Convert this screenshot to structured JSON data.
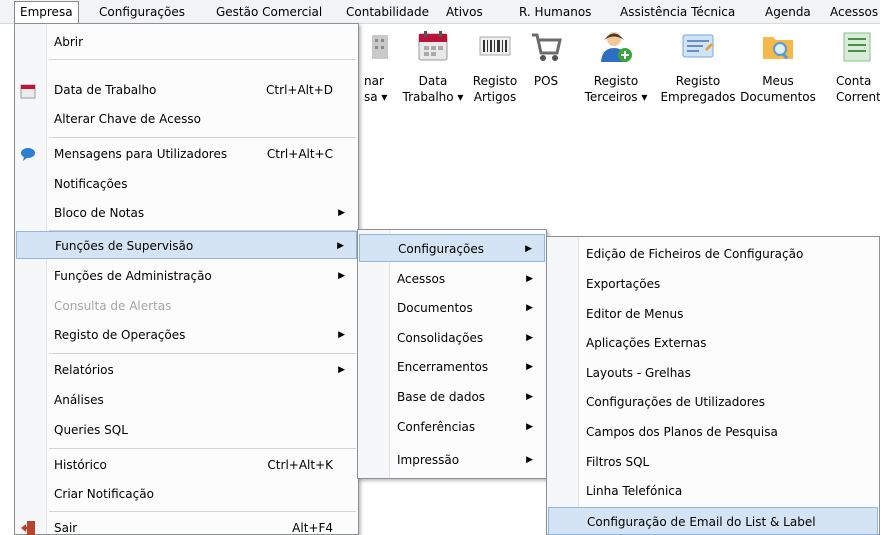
{
  "menubar": {
    "items": [
      "Empresa",
      "Configurações",
      "Gestão Comercial",
      "Contabilidade",
      "Ativos",
      "R. Humanos",
      "Assistência Técnica",
      "Agenda",
      "Acessos"
    ]
  },
  "toolbar": {
    "buttons": [
      {
        "label": "nar\nsa ▾"
      },
      {
        "label": "Data\nTrabalho ▾"
      },
      {
        "label": "Registo\nArtigos"
      },
      {
        "label": "POS"
      },
      {
        "label": "Registo\nTerceiros ▾"
      },
      {
        "label": "Registo\nEmpregados"
      },
      {
        "label": "Meus\nDocumentos"
      },
      {
        "label": "Conta\nCorrente"
      }
    ]
  },
  "menu_empresa": {
    "items": [
      {
        "label": "Abrir",
        "shortcut": ""
      },
      {
        "label": "Data de Trabalho",
        "shortcut": "Ctrl+Alt+D"
      },
      {
        "label": "Alterar Chave de Acesso",
        "shortcut": ""
      },
      {
        "label": "Mensagens para Utilizadores",
        "shortcut": "Ctrl+Alt+C"
      },
      {
        "label": "Notificações",
        "shortcut": ""
      },
      {
        "label": "Bloco de Notas",
        "shortcut": ""
      },
      {
        "label": "Funções de Supervisão",
        "shortcut": ""
      },
      {
        "label": "Funções de Administração",
        "shortcut": ""
      },
      {
        "label": "Consulta de Alertas",
        "shortcut": ""
      },
      {
        "label": "Registo de Operações",
        "shortcut": ""
      },
      {
        "label": "Relatórios",
        "shortcut": ""
      },
      {
        "label": "Análises",
        "shortcut": ""
      },
      {
        "label": "Queries SQL",
        "shortcut": ""
      },
      {
        "label": "Histórico",
        "shortcut": "Ctrl+Alt+K"
      },
      {
        "label": "Criar Notificação",
        "shortcut": ""
      },
      {
        "label": "Sair",
        "shortcut": "Alt+F4"
      }
    ]
  },
  "menu_supervisao": {
    "items": [
      "Configurações",
      "Acessos",
      "Documentos",
      "Consolidações",
      "Encerramentos",
      "Base de dados",
      "Conferências",
      "Impressão"
    ]
  },
  "menu_configuracoes": {
    "items": [
      "Edição de Ficheiros de Configuração",
      "Exportações",
      "Editor de Menus",
      "Aplicações Externas",
      "Layouts - Grelhas",
      "Configurações de Utilizadores",
      "Campos dos Planos de Pesquisa",
      "Filtros SQL",
      "Linha Telefónica",
      "Configuração de Email do List & Label"
    ]
  },
  "colors": {
    "highlight": "#d5e4f4",
    "highlight_border": "#93b6dc",
    "disabled_text": "#a5a5a5"
  }
}
